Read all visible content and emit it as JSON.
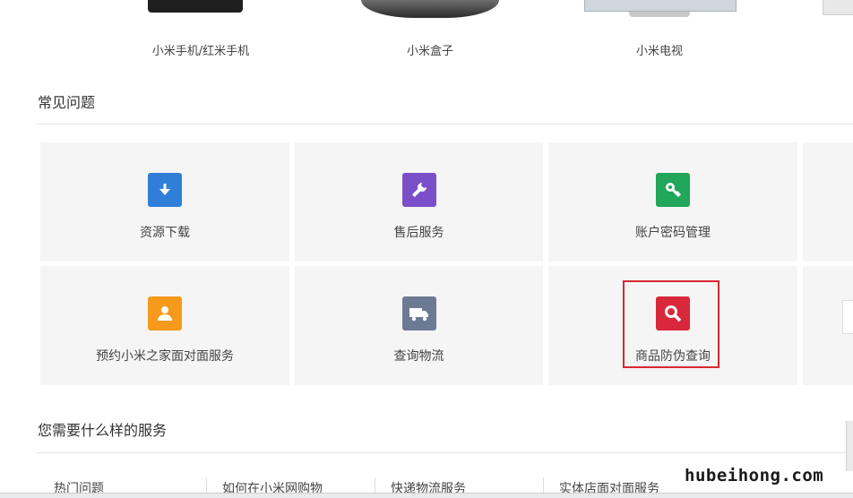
{
  "products": [
    {
      "label": "小米手机/红米手机"
    },
    {
      "label": "小米盒子"
    },
    {
      "label": "小米电视"
    }
  ],
  "faq": {
    "title": "常见问题",
    "tiles": [
      {
        "label": "资源下载",
        "icon": "download-icon",
        "color": "#2f7fd8"
      },
      {
        "label": "售后服务",
        "icon": "wrench-icon",
        "color": "#7b4fc9"
      },
      {
        "label": "账户密码管理",
        "icon": "key-icon",
        "color": "#22a65a"
      },
      {
        "label": "预约小米之家面对面服务",
        "icon": "person-icon",
        "color": "#f59a1b"
      },
      {
        "label": "查询物流",
        "icon": "truck-icon",
        "color": "#6d7a94"
      },
      {
        "label": "商品防伪查询",
        "icon": "search-icon",
        "color": "#d8283c"
      }
    ]
  },
  "services": {
    "title": "您需要什么样的服务",
    "tabs": [
      "热门问题",
      "如何在小米网购物",
      "快递物流服务",
      "实体店面对面服务"
    ]
  },
  "watermark": "hubeihong.com",
  "colors": {
    "highlight": "#d8282f",
    "tile_bg": "#f5f5f5"
  }
}
